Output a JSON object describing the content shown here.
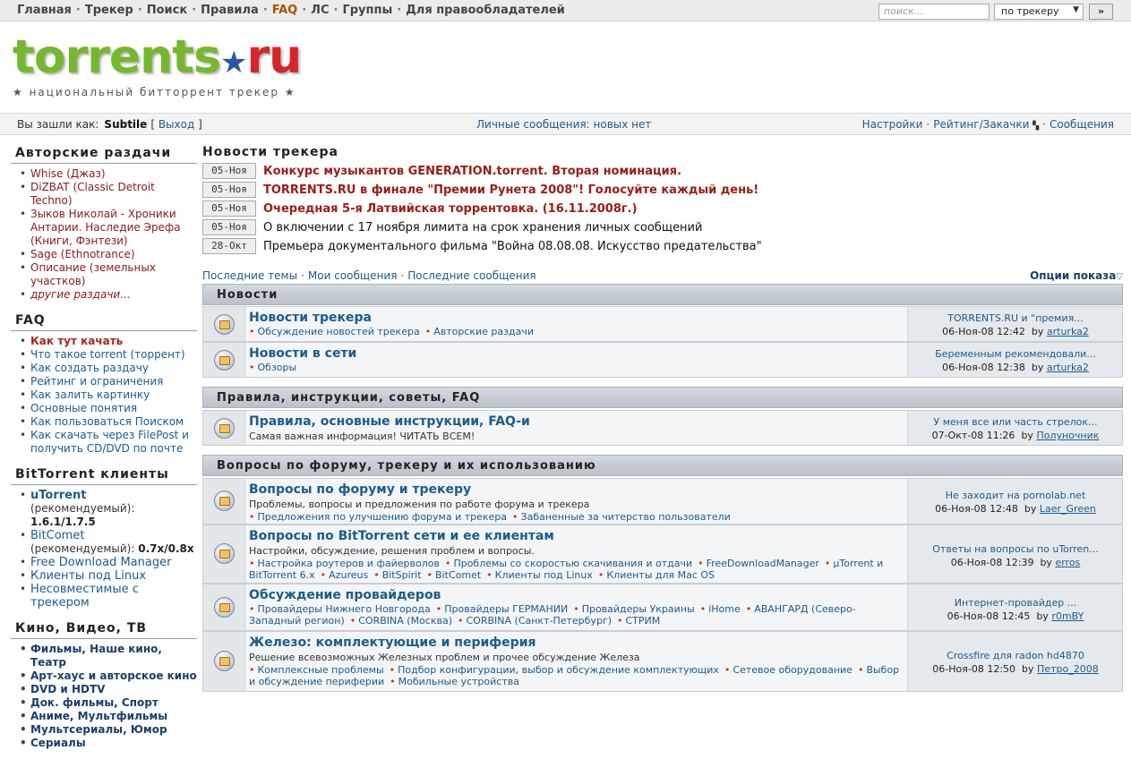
{
  "topnav": {
    "items": [
      "Главная",
      "Трекер",
      "Поиск",
      "Правила",
      "FAQ",
      "ЛС",
      "Группы",
      "Для правообладателей"
    ],
    "active_index": 4
  },
  "search": {
    "placeholder": "поиск...",
    "scope": "по трекеру",
    "go_label": "»"
  },
  "logo": {
    "main_green": "torrents",
    "main_red": "ru",
    "star": "★",
    "subtitle": "национальный битторрент трекер"
  },
  "userbar": {
    "logged_in_label": "Вы зашли как:",
    "username": "Subtile",
    "logout_label": "Выход",
    "pm_text": "Личные сообщения: новых нет",
    "settings": "Настройки",
    "rating": "Рейтинг/Закачки",
    "messages": "Сообщения"
  },
  "sidebar": {
    "authors": {
      "title": "Авторские раздачи",
      "items": [
        "Whise (Джаз)",
        "DiZBAT (Classic Detroit Techno)",
        "Зыков Николай - Хроники Антарии. Наследие Эрефа (Книги, Фэнтези)",
        "Sage (Ethnotrance)",
        "Описание (земельных участков)"
      ],
      "more": "другие раздачи..."
    },
    "faq": {
      "title": "FAQ",
      "items": [
        "Как тут качать",
        "Что такое torrent (торрент)",
        "Как создать раздачу",
        "Рейтинг и ограничения",
        "Как залить картинку",
        "Основные понятия",
        "Как пользоваться Поиском",
        "Как скачать через FilePost и получить CD/DVD по почте"
      ]
    },
    "clients": {
      "title": "BitTorrent клиенты",
      "utorrent": "uTorrent",
      "utorrent_rec": "(рекомендуемый):",
      "utorrent_ver": "1.6.1/1.7.5",
      "bitcomet": "BitComet",
      "bitcomet_rec": "(рекомендуемый):",
      "bitcomet_ver": "0.7x/0.8x",
      "fdm": "Free Download Manager",
      "linux": "Клиенты под Linux",
      "incompatible": "Несовместимые с трекером"
    },
    "video": {
      "title": "Кино, Видео, ТВ",
      "items": [
        "Фильмы, Наше кино, Театр",
        "Арт-хаус и авторское кино",
        "DVD и HDTV",
        "Док. фильмы, Спорт",
        "Аниме, Мультфильмы",
        "Мультсериалы, Юмор",
        "Сериалы"
      ]
    }
  },
  "news": {
    "title": "Новости трекера",
    "items": [
      {
        "date": "05-Ноя",
        "text": "Конкурс музыкантов GENERATION.torrent. Вторая номинация."
      },
      {
        "date": "05-Ноя",
        "text": "TORRENTS.RU в финале \"Премии Рунета 2008\"! Голосуйте каждый день!"
      },
      {
        "date": "05-Ноя",
        "text": "Очередная 5-я Латвийская торрентовка. (16.11.2008г.)"
      },
      {
        "date": "05-Ноя",
        "text": "О включении с 17 ноября лимита на срок хранения личных сообщений"
      },
      {
        "date": "28-Окт",
        "text": "Премьера документального фильма \"Война 08.08.08. Искусство предательства\""
      }
    ]
  },
  "subnav": {
    "items": [
      "Последние темы",
      "Мои сообщения",
      "Последние сообщения"
    ],
    "options": "Опции показа"
  },
  "categories": [
    {
      "title": "Новости",
      "forums": [
        {
          "name": "Новости трекера",
          "desc": "",
          "subs": [
            "Обсуждение новостей трекера",
            "Авторские раздачи"
          ],
          "last_topic": "TORRENTS.RU и \"премия...",
          "last_date": "06-Ноя-08 12:42",
          "by": "by",
          "last_user": "arturka2"
        },
        {
          "name": "Новости в сети",
          "desc": "",
          "subs": [
            "Обзоры"
          ],
          "last_topic": "Беременным рекомендовали...",
          "last_date": "06-Ноя-08 12:38",
          "by": "by",
          "last_user": "arturka2"
        }
      ]
    },
    {
      "title": "Правила, инструкции, советы, FAQ",
      "forums": [
        {
          "name": "Правила, основные инструкции, FAQ-и",
          "desc": "Самая важная информация! ЧИТАТЬ ВСЕМ!",
          "subs": [],
          "last_topic": "У меня все или часть стрелок...",
          "last_date": "07-Окт-08 11:26",
          "by": "by",
          "last_user": "Полуночник"
        }
      ]
    },
    {
      "title": "Вопросы по форуму, трекеру и их использованию",
      "forums": [
        {
          "name": "Вопросы по форуму и трекеру",
          "desc": "Проблемы, вопросы и предложения по работе форума и трекера",
          "subs": [
            "Предложения по улучшению форума и трекера",
            "Забаненные за читерство пользователи"
          ],
          "last_topic": "Не заходит на pornolab.net",
          "last_date": "06-Ноя-08 12:48",
          "by": "by",
          "last_user": "Laer_Green"
        },
        {
          "name": "Вопросы по BitTorrent сети и ее клиентам",
          "desc": "Настройки, обсуждение, решения проблем и вопросы.",
          "subs": [
            "Настройка роутеров и файерволов",
            "Проблемы со скоростью скачивания и отдачи",
            "FreeDownloadManager",
            "µTorrent и BitTorrent 6.x",
            "Azureus",
            "BitSpirit",
            "BitComet",
            "Клиенты под Linux",
            "Клиенты для Mac OS"
          ],
          "last_topic": "Ответы на вопросы по uTorren...",
          "last_date": "06-Ноя-08 12:39",
          "by": "by",
          "last_user": "erros"
        },
        {
          "name": "Обсуждение провайдеров",
          "desc": "",
          "subs": [
            "Провайдеры Нижнего Новгорода",
            "Провайдеры ГЕРМАНИИ",
            "Провайдеры Украины",
            "iHome",
            "АВАНГАРД (Северо-Западный регион)",
            "CORBINA (Москва)",
            "CORBINA (Санкт-Петербург)",
            "СТРИМ"
          ],
          "last_topic": "Интернет-провайдер ...",
          "last_date": "06-Ноя-08 12:45",
          "by": "by",
          "last_user": "r0mBY"
        },
        {
          "name": "Железо: комплектующие и периферия",
          "desc": "Решение всевозможных Железных проблем и прочее обсуждение Железа",
          "subs": [
            "Комплексные проблемы",
            "Подбор конфигурации, выбор и обсуждение комплектующих",
            "Сетевое оборудование",
            "Выбор и обсуждение периферии",
            "Мобильные устройства"
          ],
          "last_topic": "Crossfire для radon hd4870",
          "last_date": "06-Ноя-08 12:50",
          "by": "by",
          "last_user": "Петро_2008"
        }
      ]
    }
  ],
  "colors": {
    "accent_link": "#1a5c8f",
    "hot_news": "#9b1c16",
    "active_nav": "#b05000",
    "logo_green": "#74b82d",
    "logo_red": "#d6262b"
  }
}
